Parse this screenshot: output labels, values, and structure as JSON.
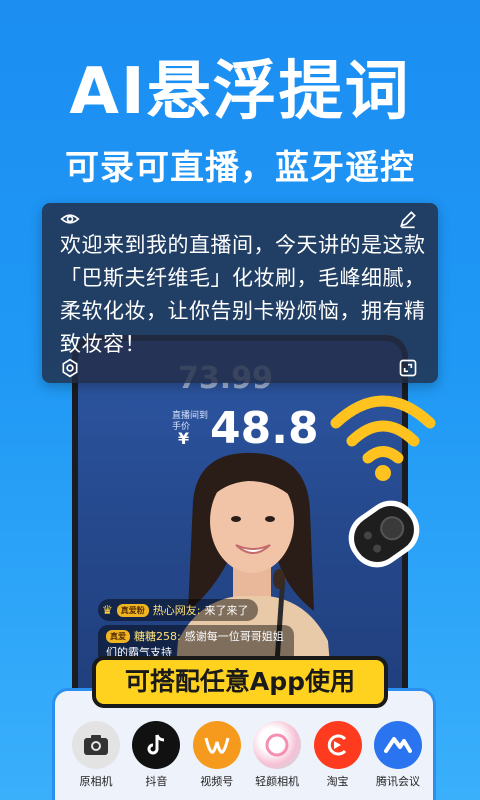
{
  "headline": "AI悬浮提词",
  "subline": "可录可直播，蓝牙遥控",
  "prompter": {
    "text_main": "欢迎来到我的直播间，今天讲的是这款「巴斯夫纤维毛」化妆刷，毛峰细腻，柔软化妆，让你告别卡粉烦恼，拥有精致妆容！"
  },
  "livestream": {
    "price_old": "73.99",
    "price_label": "直播间到手价",
    "currency": "¥",
    "price_now": "48.8",
    "comments": [
      {
        "badge": "真爱粉",
        "user": "热心网友:",
        "text": "来了来了"
      },
      {
        "badge": "真爱",
        "user": "糖糖258:",
        "text": "感谢每一位哥哥姐姐",
        "text2": "们的霸气支持"
      }
    ]
  },
  "banner": "可搭配任意App使用",
  "apps": [
    {
      "label": "原相机",
      "icon": "camera-icon",
      "color": "#e6e6e6"
    },
    {
      "label": "抖音",
      "icon": "tiktok-icon",
      "color": "#111111"
    },
    {
      "label": "视频号",
      "icon": "channels-icon",
      "color": "#f59a1c"
    },
    {
      "label": "轻颜相机",
      "icon": "qingyan-icon",
      "color": "#f4d6e4"
    },
    {
      "label": "淘宝",
      "icon": "taobao-icon",
      "color": "#ff3b1f"
    },
    {
      "label": "腾讯会议",
      "icon": "tencent-meeting-icon",
      "color": "#2a74f0"
    }
  ]
}
